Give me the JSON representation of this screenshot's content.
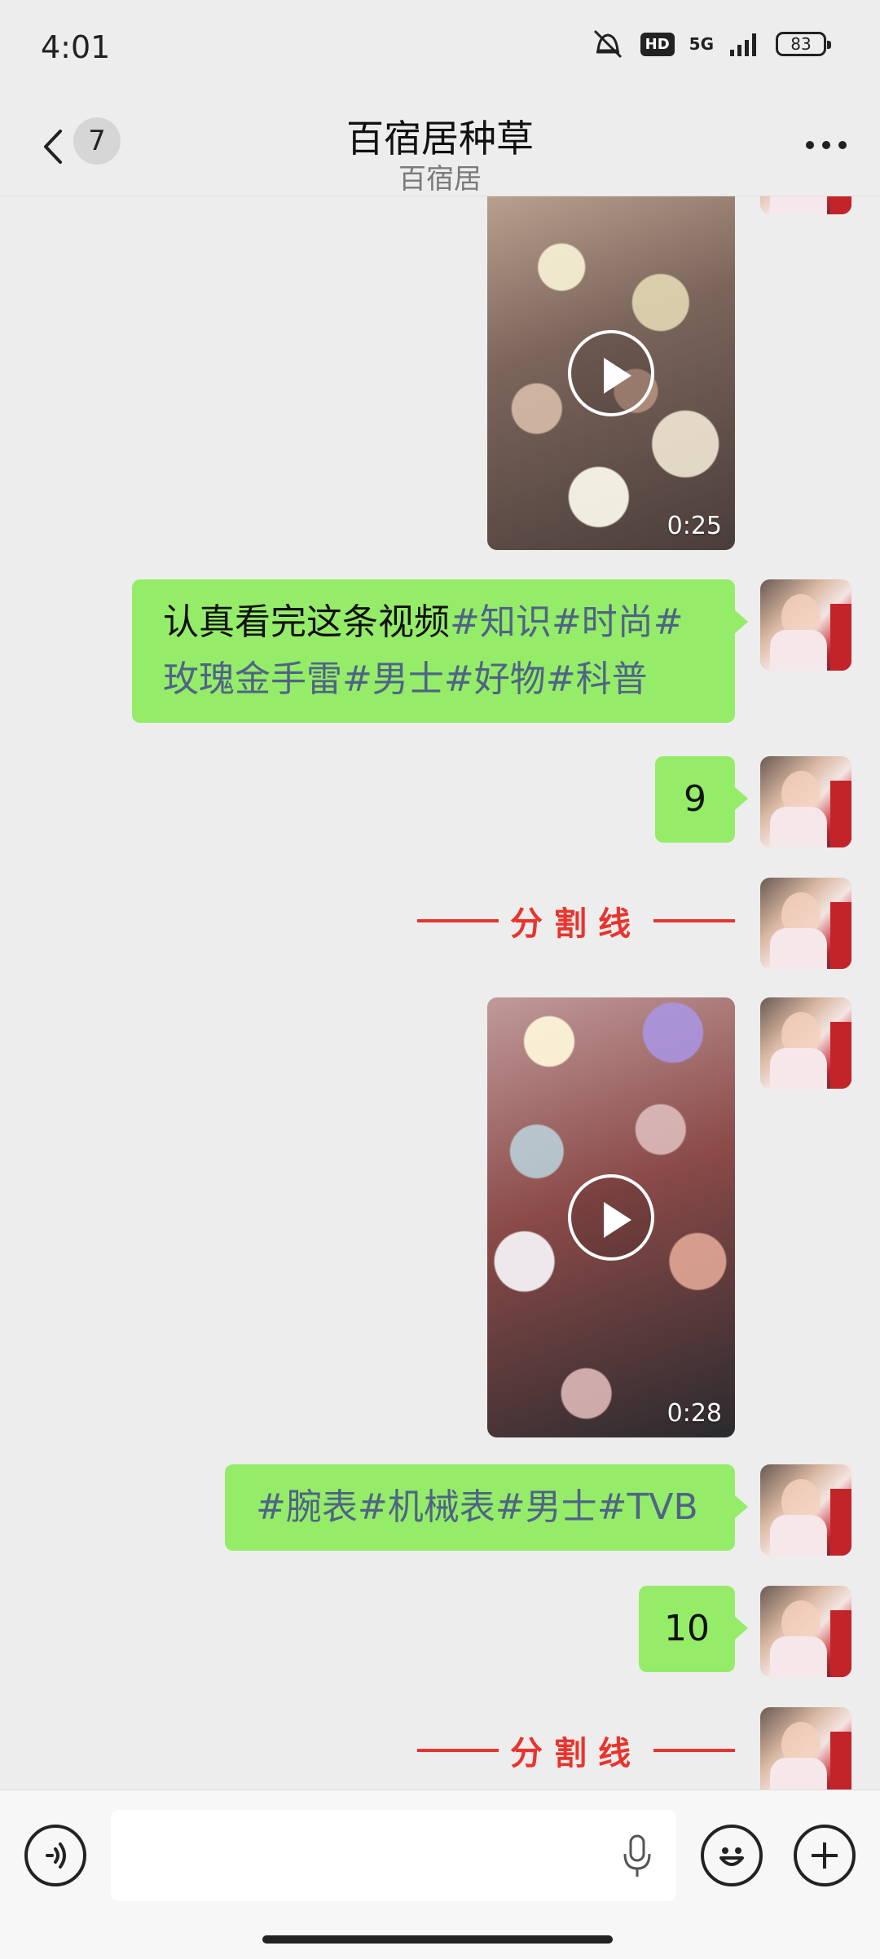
{
  "status_bar": {
    "time": "4:01",
    "hd": "HD",
    "network": "5G",
    "battery": "83"
  },
  "header": {
    "back_count": "7",
    "title": "百宿居种草",
    "subtitle": "百宿居",
    "more_icon": "more-icon"
  },
  "messages": {
    "video1_duration": "0:25",
    "text1_line1_plain": "认真看完这条视频",
    "text1_line1_tags": "#知识#时尚#",
    "text1_line2_tags": "玫瑰金手雷#男士#好物#科普",
    "text2": "9",
    "divider1": "分割线",
    "video2_duration": "0:28",
    "text3_tags": "#腕表#机械表#男士#TVB",
    "text4": "10",
    "divider2": "分割线"
  },
  "colors": {
    "bubble": "#95ec69",
    "tag": "#4f6485",
    "divider": "#e8342e",
    "background": "#ededed"
  },
  "input": {
    "placeholder": ""
  }
}
